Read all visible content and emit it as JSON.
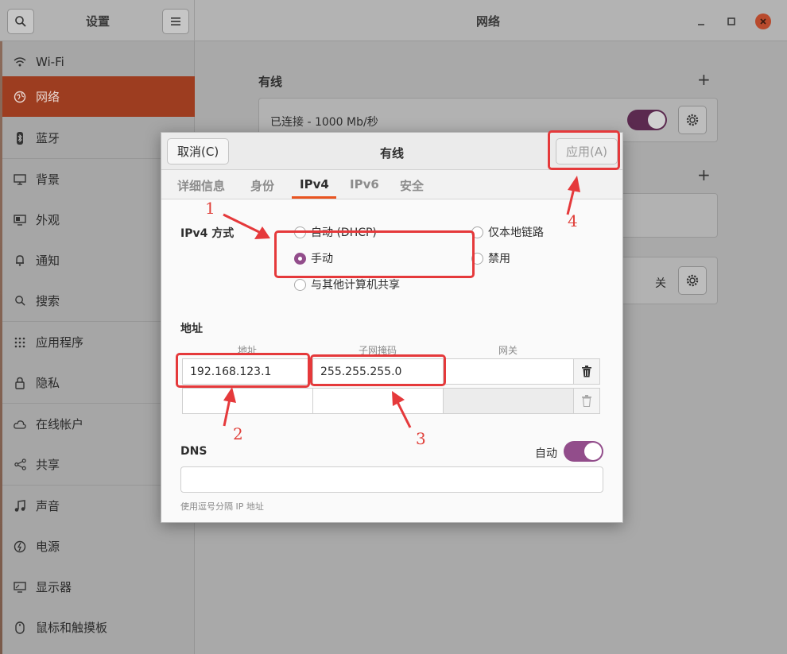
{
  "sidebar_header": {
    "title": "设置"
  },
  "main_header": {
    "title": "网络"
  },
  "sidebar": {
    "items": [
      {
        "label": "Wi-Fi",
        "icon": "wifi-icon"
      },
      {
        "label": "网络",
        "icon": "network-icon",
        "active": true
      },
      {
        "label": "蓝牙",
        "icon": "bluetooth-icon"
      },
      {
        "label": "背景",
        "icon": "background-icon"
      },
      {
        "label": "外观",
        "icon": "appearance-icon"
      },
      {
        "label": "通知",
        "icon": "bell-icon"
      },
      {
        "label": "搜索",
        "icon": "search-icon"
      },
      {
        "label": "应用程序",
        "icon": "apps-grid-icon"
      },
      {
        "label": "隐私",
        "icon": "lock-icon"
      },
      {
        "label": "在线帐户",
        "icon": "cloud-icon"
      },
      {
        "label": "共享",
        "icon": "share-icon"
      },
      {
        "label": "声音",
        "icon": "music-note-icon"
      },
      {
        "label": "电源",
        "icon": "power-icon"
      },
      {
        "label": "显示器",
        "icon": "display-icon"
      },
      {
        "label": "鼠标和触摸板",
        "icon": "mouse-icon"
      }
    ]
  },
  "main": {
    "wired_section_title": "有线",
    "wired_status": "已连接 - 1000 Mb/秒",
    "vpn_status": "关"
  },
  "dialog": {
    "title": "有线",
    "cancel_label": "取消(C)",
    "apply_label": "应用(A)",
    "tabs": [
      "详细信息",
      "身份",
      "IPv4",
      "IPv6",
      "安全"
    ],
    "active_tab": "IPv4",
    "ipv4_method_label": "IPv4 方式",
    "methods": {
      "auto": "自动 (DHCP)",
      "manual": "手动",
      "shared": "与其他计算机共享",
      "link_local": "仅本地链路",
      "disabled": "禁用"
    },
    "selected_method": "手动",
    "address_section_label": "地址",
    "columns": [
      "地址",
      "子网掩码",
      "网关"
    ],
    "address_row": {
      "address": "192.168.123.1",
      "netmask": "255.255.255.0",
      "gateway": ""
    },
    "dns_label": "DNS",
    "dns_auto_label": "自动",
    "dns_hint": "使用逗号分隔 IP 地址"
  },
  "annotations": [
    "1",
    "2",
    "3",
    "4"
  ],
  "colors": {
    "accent": "#e95420",
    "sidebar_active": "#9d3d20",
    "toggle_on": "#924d8b",
    "annotation_red": "#e5393b"
  }
}
